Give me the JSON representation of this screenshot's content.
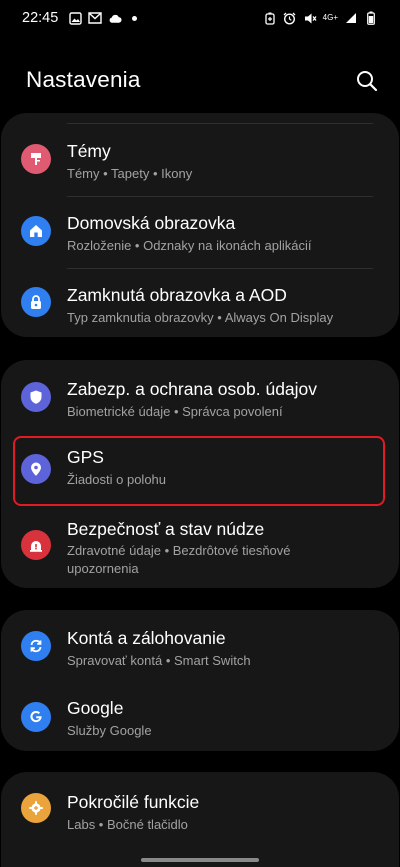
{
  "status_bar": {
    "time": "22:45",
    "network": "4G+",
    "icons_left": [
      "gallery-icon",
      "gmail-icon",
      "cloud-icon",
      "notification-dot"
    ],
    "icons_right": [
      "battery-saver-icon",
      "alarm-icon",
      "mute-icon",
      "signal-icon",
      "battery-icon"
    ]
  },
  "header": {
    "title": "Nastavenia"
  },
  "groups": [
    {
      "items": [
        {
          "title": "Témy",
          "subtitle": "Témy • Tapety • Ikony",
          "icon": "themes-icon",
          "color": "#e05a72"
        },
        {
          "title": "Domovská obrazovka",
          "subtitle": "Rozloženie • Odznaky na ikonách aplikácií",
          "icon": "home-icon",
          "color": "#2f7ff0"
        },
        {
          "title": "Zamknutá obrazovka a AOD",
          "subtitle": "Typ zamknutia obrazovky • Always On Display",
          "icon": "lock-icon",
          "color": "#2f7ff0"
        }
      ]
    },
    {
      "items": [
        {
          "title": "Zabezp. a ochrana osob. údajov",
          "subtitle": "Biometrické údaje • Správca povolení",
          "icon": "shield-icon",
          "color": "#5d63d8"
        },
        {
          "title": "GPS",
          "subtitle": "Žiadosti o polohu",
          "icon": "location-pin-icon",
          "color": "#5d63d8"
        },
        {
          "title": "Bezpečnosť a stav núdze",
          "subtitle": "Zdravotné údaje • Bezdrôtové tiesňové upozornenia",
          "icon": "emergency-icon",
          "color": "#d8323c"
        }
      ]
    },
    {
      "items": [
        {
          "title": "Kontá a zálohovanie",
          "subtitle": "Spravovať kontá • Smart Switch",
          "icon": "sync-icon",
          "color": "#2f7ff0"
        },
        {
          "title": "Google",
          "subtitle": "Služby Google",
          "icon": "google-icon",
          "color": "#2f7ff0"
        }
      ]
    },
    {
      "items": [
        {
          "title": "Pokročilé funkcie",
          "subtitle": "Labs • Bočné tlačidlo",
          "icon": "gear-plus-icon",
          "color": "#eaa43b"
        }
      ]
    }
  ],
  "highlight_color": "#e21a24"
}
